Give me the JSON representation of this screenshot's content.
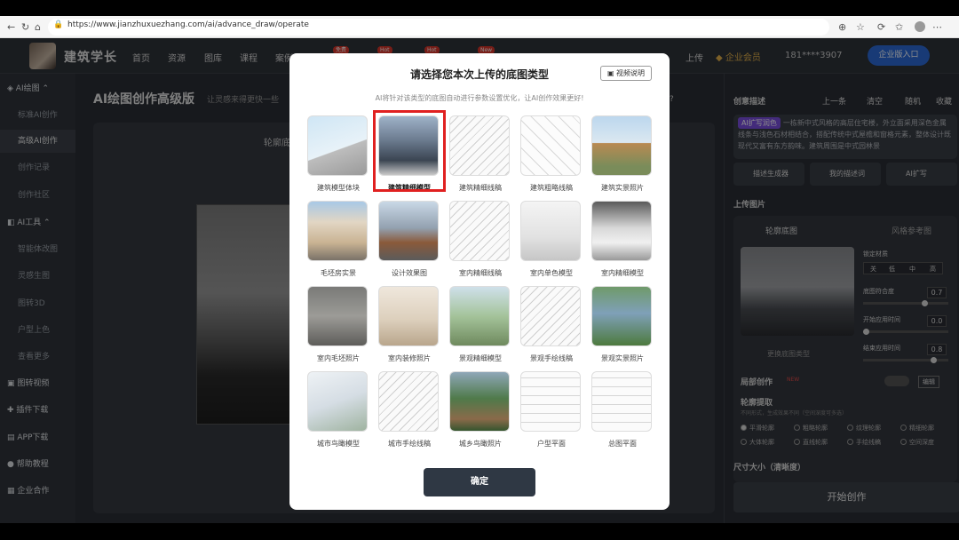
{
  "browser": {
    "url": "https://www.jianzhuxuezhang.com/ai/advance_draw/operate"
  },
  "header": {
    "brand": "建筑学长",
    "nav": [
      {
        "label": "首页"
      },
      {
        "label": "资源"
      },
      {
        "label": "图库"
      },
      {
        "label": "课程"
      },
      {
        "label": "案例"
      }
    ],
    "badges": [
      "免费",
      "Hot",
      "Hot",
      "New"
    ],
    "upload": "上传",
    "member": "企业会员",
    "phone": "181****3907",
    "enterprise_button": "企业版入口"
  },
  "sidebar": {
    "items": [
      {
        "label": "AI绘图",
        "type": "header"
      },
      {
        "label": "标准AI创作"
      },
      {
        "label": "高级AI创作",
        "active": true
      },
      {
        "label": "创作记录"
      },
      {
        "label": "创作社区"
      },
      {
        "label": "AI工具",
        "type": "header"
      },
      {
        "label": "智能体改图"
      },
      {
        "label": "灵感生图"
      },
      {
        "label": "图转3D"
      },
      {
        "label": "户型上色"
      },
      {
        "label": "查看更多"
      },
      {
        "label": "图转视频",
        "type": "header"
      },
      {
        "label": "插件下载",
        "type": "header"
      },
      {
        "label": "APP下载",
        "type": "header"
      },
      {
        "label": "帮助教程",
        "type": "header"
      },
      {
        "label": "企业合作",
        "type": "header"
      }
    ]
  },
  "main": {
    "title": "AI绘图创作高级版",
    "subtitle": "让灵感来得更快一些",
    "canvas_label": "轮廓底图",
    "partial_text": "染?"
  },
  "right": {
    "section_title": "创意描述",
    "actions": [
      "上一条",
      "清空",
      "随机",
      "收藏"
    ],
    "tag": "AI扩写润色",
    "description": "一栋新中式风格的高层住宅楼，外立面采用深色金属线条与浅色石材相结合，搭配传统中式屋檐和窗格元素，整体设计既现代又富有东方韵味。建筑周围是中式园林景",
    "buttons": [
      "描述生成器",
      "我的描述词",
      "AI扩写"
    ],
    "upload_title": "上传图片",
    "tabs": [
      "轮廓底图",
      "风格参考图"
    ],
    "lock_label": "锁定材质",
    "lock_options": [
      "关",
      "低",
      "中",
      "高"
    ],
    "params": [
      {
        "label": "底图符合度",
        "value": "0.7"
      },
      {
        "label": "开始应用时间",
        "value": "0.0"
      },
      {
        "label": "结束应用时间",
        "value": "0.8"
      }
    ],
    "replace_label": "更换底图类型",
    "local_label": "局部创作",
    "new_badge": "NEW",
    "edit_label": "编辑",
    "outline_title": "轮廓提取",
    "outline_sub": "不同形式，生成效果不同（空间深度可多选）",
    "radios": [
      "平滑轮廓",
      "粗略轮廓",
      "纹理轮廓",
      "精细轮廓",
      "大体轮廓",
      "直线轮廓",
      "手绘线稿",
      "空间深度"
    ],
    "size_label": "尺寸大小（清晰度）",
    "start_button": "开始创作"
  },
  "modal": {
    "title": "请选择您本次上传的底图类型",
    "video_button": "视频说明",
    "subtitle": "AI将针对该类型的底图自动进行参数设置优化，让AI创作效果更好!",
    "types": [
      {
        "label": "建筑模型体块",
        "selected": false,
        "style": "massing"
      },
      {
        "label": "建筑精细模型",
        "selected": true,
        "style": "fine"
      },
      {
        "label": "建筑精细线稿",
        "selected": false,
        "style": "line"
      },
      {
        "label": "建筑粗略线稿",
        "selected": false,
        "style": "sketch"
      },
      {
        "label": "建筑实景照片",
        "selected": false,
        "style": "photo"
      },
      {
        "label": "毛坯房实景",
        "selected": false,
        "style": "rough"
      },
      {
        "label": "设计效果图",
        "selected": false,
        "style": "render"
      },
      {
        "label": "室内精细线稿",
        "selected": false,
        "style": "line"
      },
      {
        "label": "室内单色模型",
        "selected": false,
        "style": "white"
      },
      {
        "label": "室内精细模型",
        "selected": false,
        "style": "interior"
      },
      {
        "label": "室内毛坯照片",
        "selected": false,
        "style": "concrete"
      },
      {
        "label": "室内装修照片",
        "selected": false,
        "style": "beige"
      },
      {
        "label": "景观精细模型",
        "selected": false,
        "style": "land"
      },
      {
        "label": "景观手绘线稿",
        "selected": false,
        "style": "line"
      },
      {
        "label": "景观实景照片",
        "selected": false,
        "style": "green"
      },
      {
        "label": "城市鸟瞰模型",
        "selected": false,
        "style": "city"
      },
      {
        "label": "城市手绘线稿",
        "selected": false,
        "style": "line"
      },
      {
        "label": "城乡鸟瞰照片",
        "selected": false,
        "style": "village"
      },
      {
        "label": "户型平面",
        "selected": false,
        "style": "plan"
      },
      {
        "label": "总图平面",
        "selected": false,
        "style": "plan"
      }
    ],
    "confirm": "确定"
  }
}
